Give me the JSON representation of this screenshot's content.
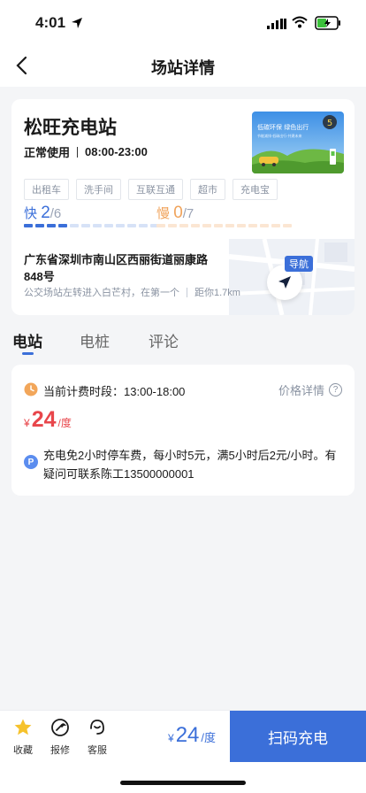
{
  "status_bar": {
    "time": "4:01"
  },
  "nav": {
    "title": "场站详情"
  },
  "station": {
    "name": "松旺充电站",
    "status": "正常使用",
    "hours": "08:00-23:00",
    "tags": [
      "出租车",
      "洗手间",
      "互联互通",
      "超市",
      "充电宝"
    ],
    "banner": {
      "line1": "低碳环保 绿色出行",
      "line2": "节能减排·低碳出行·共建未来",
      "badge": "5"
    },
    "fast": {
      "label": "快",
      "available": "2",
      "total": "/6",
      "available_fraction": 0.333
    },
    "slow": {
      "label": "慢",
      "available": "0",
      "total": "/7",
      "available_fraction": 0
    },
    "address": "广东省深圳市南山区西丽街道丽康路848号",
    "direction": "公交场站左转进入白芒村，在第一个",
    "distance": "距你1.7km",
    "nav_label": "导航"
  },
  "tabs": [
    {
      "label": "电站"
    },
    {
      "label": "电桩"
    },
    {
      "label": "评论"
    }
  ],
  "pricing": {
    "period_label": "当前计费时段：",
    "period": "13:00-18:00",
    "detail_label": "价格详情",
    "currency": "¥",
    "price": "24",
    "unit": "/度",
    "parking_badge": "P",
    "parking_note": "充电免2小时停车费，每小时5元，满5小时后2元/小时。有疑问可联系陈工13500000001"
  },
  "footer": {
    "favorite": "收藏",
    "report": "报修",
    "service": "客服",
    "currency": "¥",
    "price": "24",
    "unit": "/度",
    "scan": "扫码充电"
  },
  "colors": {
    "accent": "#3b6fd9",
    "price_red": "#e8464b",
    "slow_orange": "#f0a35b"
  }
}
